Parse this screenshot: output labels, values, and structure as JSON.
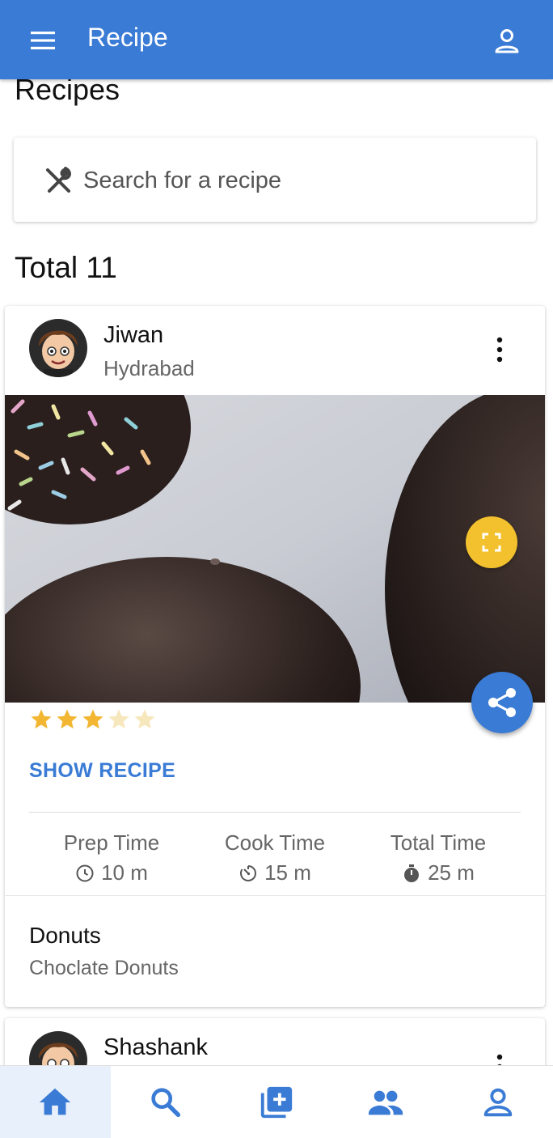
{
  "appbar": {
    "title": "Recipe",
    "menu_icon": "menu-icon",
    "account_icon": "account-icon",
    "color": "#3a7bd5"
  },
  "page": {
    "heading": "Recipes"
  },
  "search": {
    "placeholder": "Search for a recipe",
    "value": "",
    "icon": "utensils-icon"
  },
  "summary": {
    "total_label": "Total 11"
  },
  "recipes": [
    {
      "user": "Jiwan",
      "location": "Hydrabad",
      "rating": 3,
      "rating_max": 5,
      "show_label": "SHOW RECIPE",
      "times": [
        {
          "label": "Prep Time",
          "value": "10 m",
          "icon": "clock-icon"
        },
        {
          "label": "Cook Time",
          "value": "15 m",
          "icon": "timer-icon"
        },
        {
          "label": "Total Time",
          "value": "25 m",
          "icon": "stopwatch-icon"
        }
      ],
      "name": "Donuts",
      "description": "Choclate Donuts"
    },
    {
      "user": "Shashank"
    }
  ],
  "bottom_nav": [
    {
      "icon": "home-icon",
      "active": true
    },
    {
      "icon": "search-icon",
      "active": false
    },
    {
      "icon": "add-box-icon",
      "active": false
    },
    {
      "icon": "people-icon",
      "active": false
    },
    {
      "icon": "account-icon",
      "active": false
    }
  ],
  "colors": {
    "primary": "#3a7bd5",
    "accent": "#f3c12e",
    "star": "#f2b632"
  }
}
